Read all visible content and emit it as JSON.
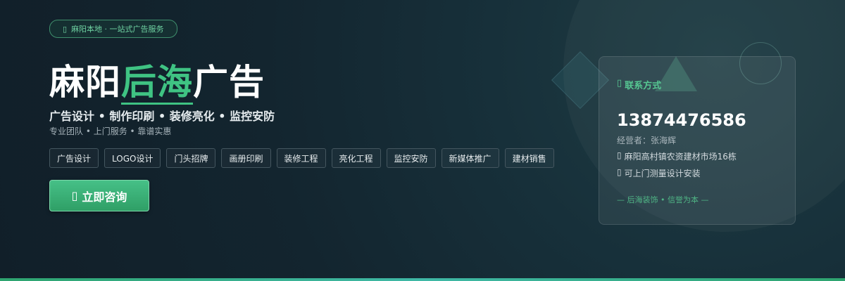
{
  "tag": {
    "icon": "location-pin-icon",
    "text": "麻阳本地 · 一站式广告服务"
  },
  "title": {
    "part1": "麻阳",
    "highlight": "后海",
    "part2": "广告"
  },
  "services_line": "广告设计 • 制作印刷 • 装修亮化 • 监控安防",
  "subline": "专业团队 • 上门服务 • 靠谱实惠",
  "chips": [
    "广告设计",
    "LOGO设计",
    "门头招牌",
    "画册印刷",
    "装修工程",
    "亮化工程",
    "监控安防",
    "新媒体推广",
    "建材销售"
  ],
  "cta": {
    "icon": "phone-icon",
    "label": "立即咨询"
  },
  "contact": {
    "heading": "联系方式",
    "phone": "13874476586",
    "operator": "经营者：张海辉",
    "address": "麻阳高村镇农资建材市场16栋",
    "service_note": "可上门测量设计安装",
    "slogan": "— 后海装饰 • 信誉为本 —"
  },
  "colors": {
    "accent": "#3fc383",
    "background": "#13252f"
  }
}
